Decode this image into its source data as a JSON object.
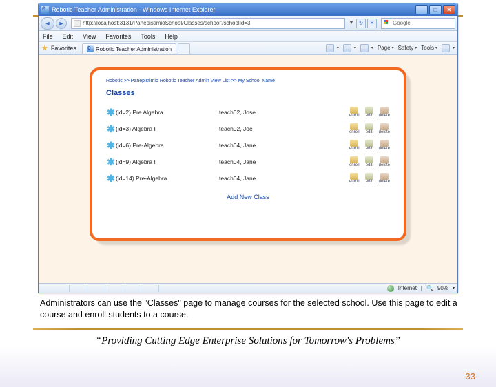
{
  "window": {
    "title": "Robotic Teacher Administration - Windows Internet Explorer",
    "url": "http://localhost:3131/PanepistimioSchool/Classes/school?schoolId=3",
    "search_placeholder": "Google",
    "menu": [
      "File",
      "Edit",
      "View",
      "Favorites",
      "Tools",
      "Help"
    ],
    "fav_label": "Favorites",
    "tab_label": "Robotic Teacher Administration",
    "toolbar": {
      "page": "Page",
      "safety": "Safety",
      "tools": "Tools"
    },
    "status": {
      "zone": "Internet",
      "zoom": "90%"
    }
  },
  "page": {
    "breadcrumb": "Robotic >> Panepistimio Robotic Teacher Admin View List >> My School Name",
    "heading": "Classes",
    "rows": [
      {
        "class": "(id=2) Pre Algebra",
        "teacher": "teach02, Jose"
      },
      {
        "class": "(id=3) Algebra I",
        "teacher": "teach02, Joe"
      },
      {
        "class": "(id=6) Pre-Algebra",
        "teacher": "teach04, Jane"
      },
      {
        "class": "(id=9) Algebra I",
        "teacher": "teach04, Jane"
      },
      {
        "class": "(id=14) Pre-Algebra",
        "teacher": "teach04, Jane"
      }
    ],
    "actions": {
      "enroll": "enroll",
      "edit": "edit",
      "delete": "delete"
    },
    "add_new": "Add New Class"
  },
  "slide": {
    "caption": "Administrators can use the \"Classes\" page to manage courses for the selected school.  Use this page to edit a course and enroll students to a course.",
    "tagline": "“Providing Cutting Edge Enterprise Solutions for Tomorrow's Problems”",
    "pagenum": "33"
  }
}
